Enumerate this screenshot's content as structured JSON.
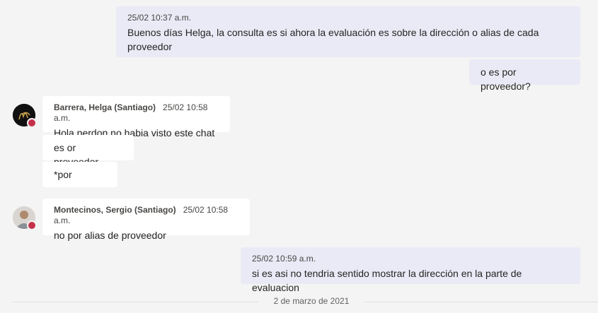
{
  "messages": [
    {
      "time": "25/02 10:37 a.m.",
      "text": "Buenos días Helga, la consulta es si ahora la evaluación es sobre la dirección o alias de cada proveedor"
    },
    {
      "text": "o es por proveedor?"
    },
    {
      "author": "Barrera, Helga (Santiago)",
      "time": "25/02 10:58 a.m.",
      "text": "Hola perdon no habia visto este chat"
    },
    {
      "text": "es or proveedor"
    },
    {
      "text": "*por"
    },
    {
      "author": "Montecinos, Sergio (Santiago)",
      "time": "25/02 10:58 a.m.",
      "text": "no por alias de proveedor"
    },
    {
      "time": "25/02 10:59 a.m.",
      "text": "si es asi no tendria sentido mostrar la dirección en la parte de evaluacion"
    }
  ],
  "date_divider": "2 de marzo de 2021",
  "colors": {
    "mine_bubble": "#e9eaf6",
    "their_bubble": "#ffffff",
    "status_busy": "#c4314b"
  }
}
